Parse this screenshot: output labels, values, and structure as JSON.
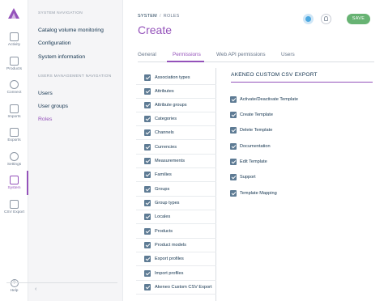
{
  "rail": {
    "items": [
      {
        "label": "Activity",
        "icon": "dashboard-icon"
      },
      {
        "label": "Products",
        "icon": "products-icon"
      },
      {
        "label": "Connect",
        "icon": "connect-icon"
      },
      {
        "label": "Imports",
        "icon": "imports-icon"
      },
      {
        "label": "Exports",
        "icon": "exports-icon"
      },
      {
        "label": "Settings",
        "icon": "settings-icon"
      },
      {
        "label": "System",
        "icon": "system-icon",
        "active": true
      },
      {
        "label": "CSV Export",
        "icon": "csv-export-icon"
      }
    ],
    "help_label": "Help"
  },
  "subnav": {
    "system_header": "SYSTEM NAVIGATION",
    "system_links": [
      "Catalog volume monitoring",
      "Configuration",
      "System information"
    ],
    "users_header": "USERS MANAGEMENT NAVIGATION",
    "users_links": [
      "Users",
      "User groups",
      "Roles"
    ],
    "active_link": "Roles"
  },
  "header": {
    "breadcrumb_root": "SYSTEM",
    "breadcrumb_separator": "/",
    "breadcrumb_current": "ROLES",
    "title": "Create",
    "save_label": "SAVE"
  },
  "tabs": [
    "General",
    "Permissions",
    "Web API permissions",
    "Users"
  ],
  "active_tab": "Permissions",
  "groups": [
    "Association types",
    "Attributes",
    "Attribute groups",
    "Categories",
    "Channels",
    "Currencies",
    "Measurements",
    "Families",
    "Groups",
    "Group types",
    "Locales",
    "Products",
    "Product models",
    "Export profiles",
    "Import profiles",
    "Akeneo Custom CSV Export"
  ],
  "permissions": {
    "title": "AKENEO CUSTOM CSV EXPORT",
    "items": [
      "Activate/Deactivate Template",
      "Create Template",
      "Delete Template",
      "Documentation",
      "Edit Template",
      "Support",
      "Template Mapping"
    ]
  },
  "colors": {
    "accent": "#9452ba",
    "save": "#67b373",
    "checkbox": "#5e7b94"
  }
}
